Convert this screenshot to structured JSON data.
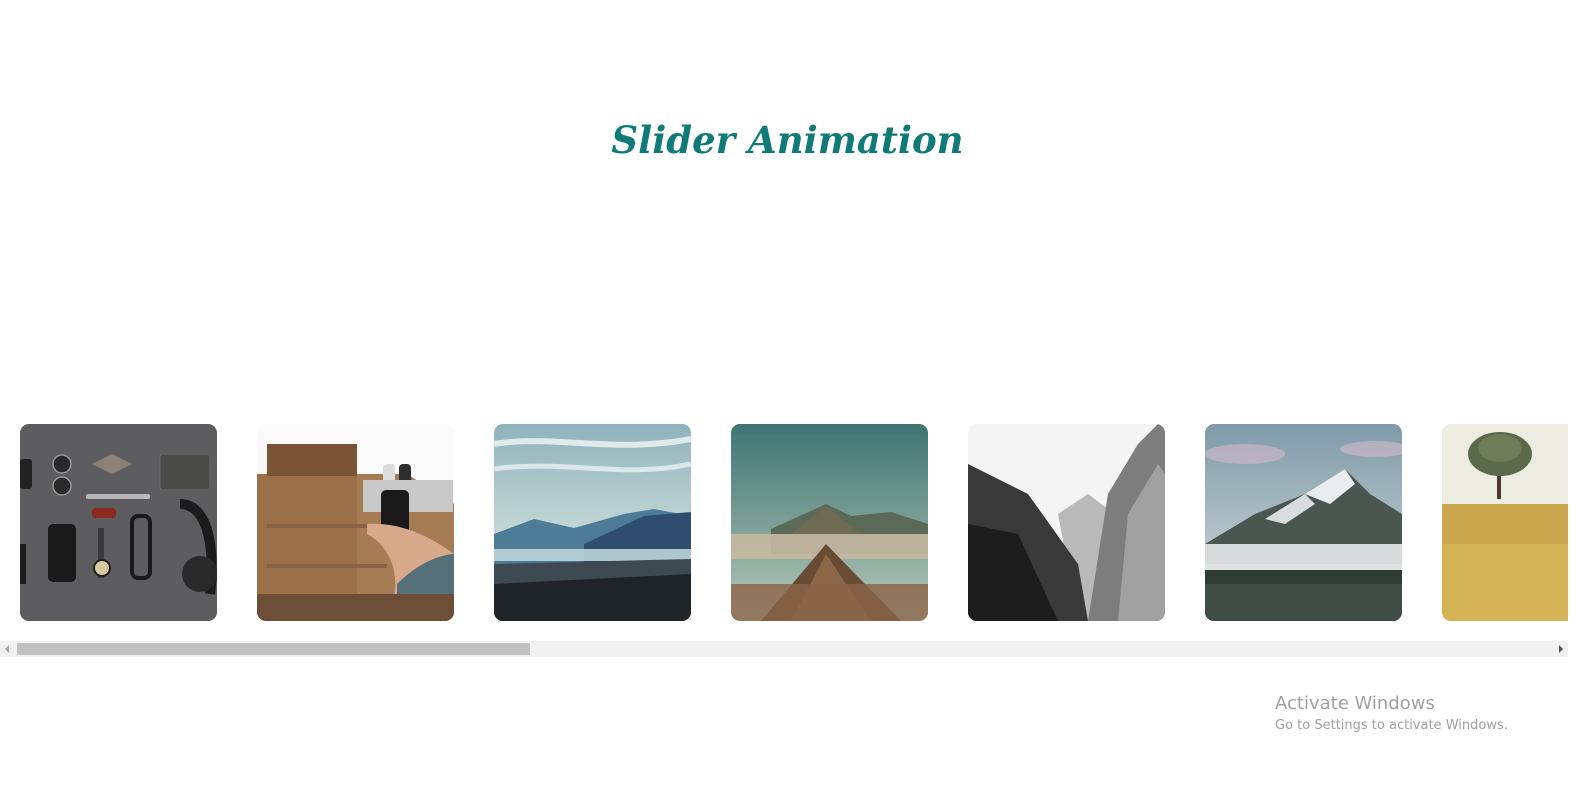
{
  "page": {
    "title": "Slider Animation",
    "title_color": "#0f7a78"
  },
  "slider": {
    "slides": [
      {
        "name": "flatlay-accessories",
        "palette": [
          "#5f5f61",
          "#3a3a3c"
        ]
      },
      {
        "name": "wooden-table-phone",
        "palette": [
          "#a27952",
          "#f4f4f4"
        ]
      },
      {
        "name": "mountain-valley-mist",
        "palette": [
          "#cfe3e6",
          "#3b5673"
        ]
      },
      {
        "name": "volcano-bromo",
        "palette": [
          "#4f7f80",
          "#8e6a4c"
        ]
      },
      {
        "name": "monochrome-gorge",
        "palette": [
          "#f2f2f2",
          "#2c2c2c"
        ]
      },
      {
        "name": "snowy-peak-lake",
        "palette": [
          "#c9d5dc",
          "#3c4a45"
        ]
      },
      {
        "name": "tree-yellow-field",
        "palette": [
          "#e9ead9",
          "#c8a84a"
        ]
      }
    ],
    "scroll_progress": 0.0
  },
  "watermark": {
    "title": "Activate Windows",
    "subtitle": "Go to Settings to activate Windows."
  }
}
